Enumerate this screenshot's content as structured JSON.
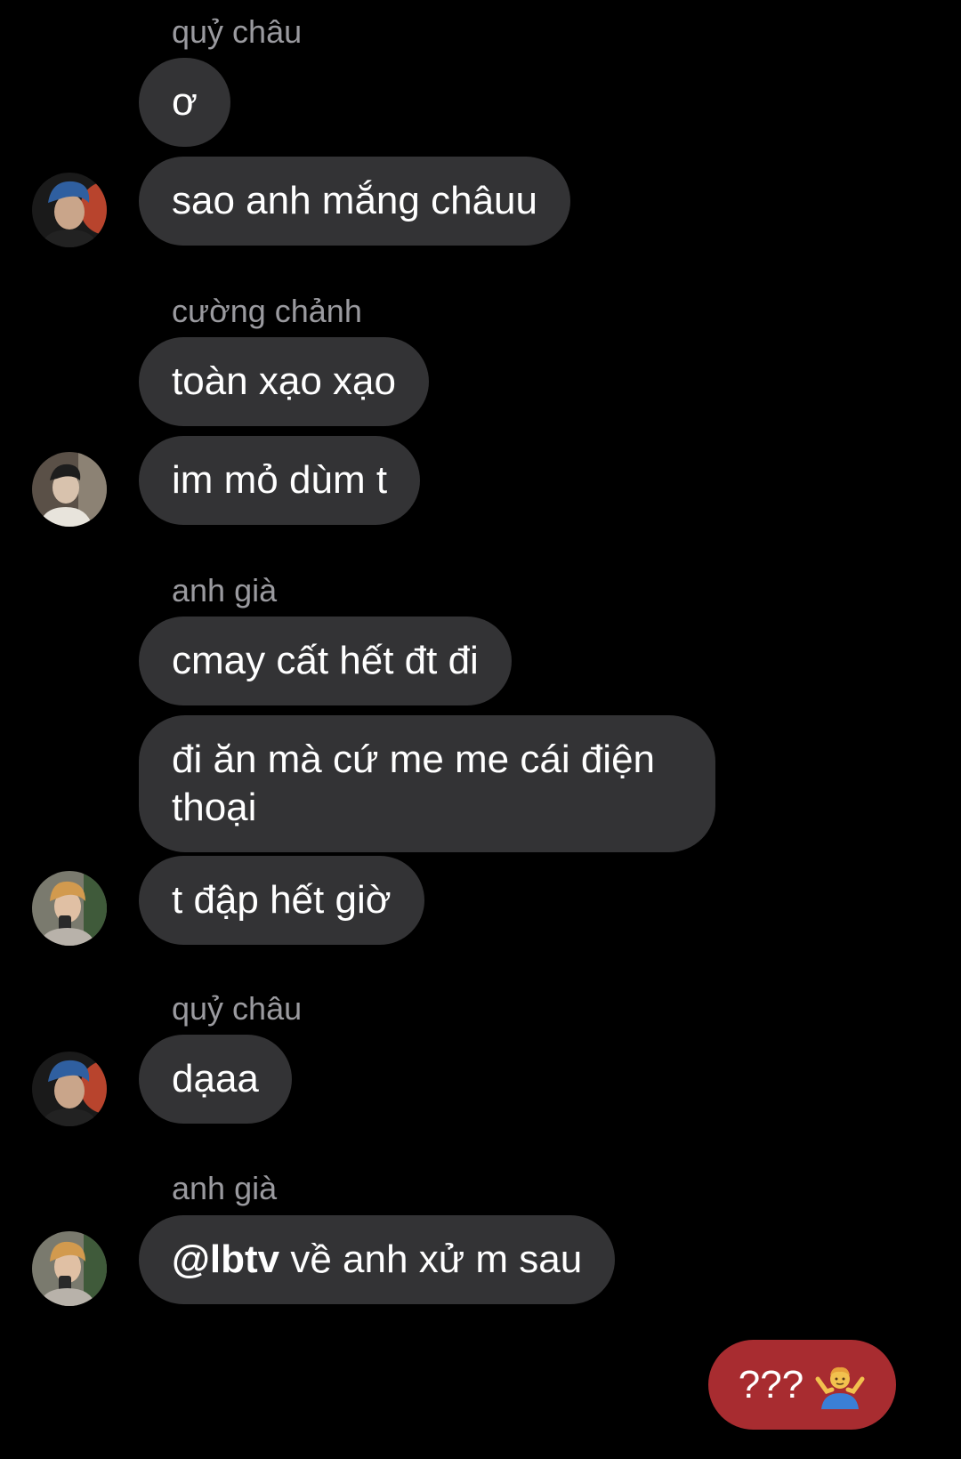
{
  "messages": {
    "g1": {
      "sender": "quỷ châu",
      "m1": "ơ",
      "m2": "sao anh mắng châuu"
    },
    "g2": {
      "sender": "cường chảnh",
      "m1": "toàn xạo xạo",
      "m2": "im mỏ dùm t"
    },
    "g3": {
      "sender": "anh già",
      "m1": "cmay cất hết đt đi",
      "m2": "đi ăn mà cứ me me cái điện thoại",
      "m3": "t đập hết giờ"
    },
    "g4": {
      "sender": "quỷ châu",
      "m1": "dạaa"
    },
    "g5": {
      "sender": "anh già",
      "mention": "@lbtv",
      "m1_rest": " về anh xử m sau"
    },
    "outgoing": {
      "text": "???",
      "emoji_icon": "man-shrugging-icon"
    }
  },
  "colors": {
    "background": "#000000",
    "incoming_bubble": "#333335",
    "outgoing_bubble": "#a82c30",
    "sender_name": "#9a9a9f"
  }
}
